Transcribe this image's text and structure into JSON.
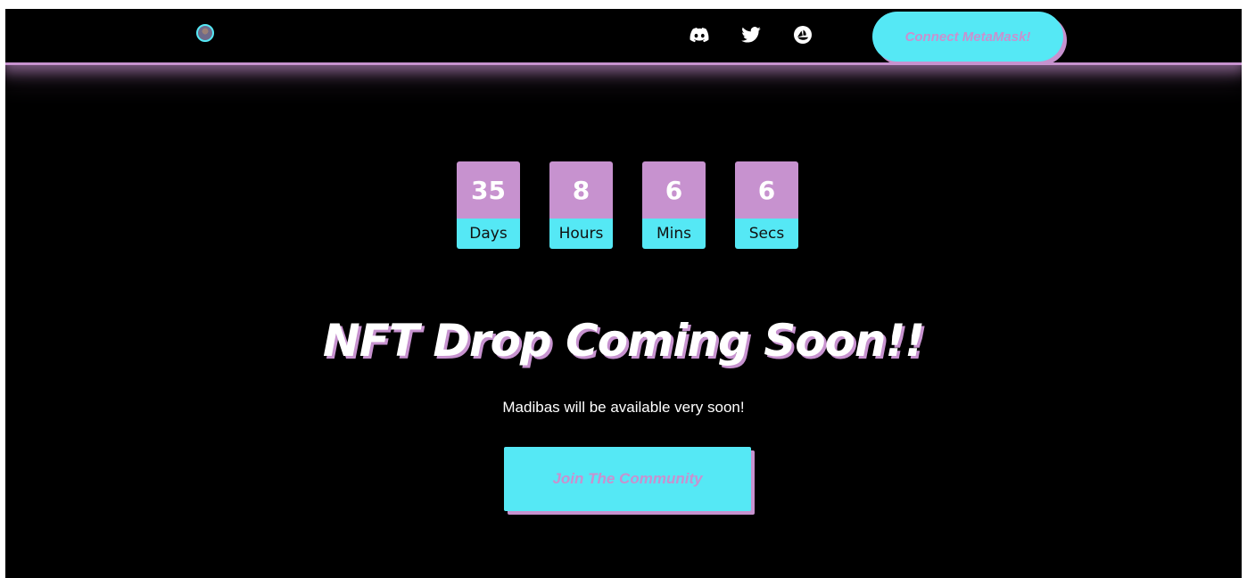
{
  "navbar": {
    "avatar_icon": "avatar-logo",
    "social_links": [
      {
        "icon": "discord-icon"
      },
      {
        "icon": "twitter-icon"
      },
      {
        "icon": "opensea-icon"
      }
    ],
    "connect_label": "Connect MetaMask!"
  },
  "countdown": {
    "units": [
      {
        "value": "35",
        "label": "Days"
      },
      {
        "value": "8",
        "label": "Hours"
      },
      {
        "value": "6",
        "label": "Mins"
      },
      {
        "value": "6",
        "label": "Secs"
      }
    ]
  },
  "hero": {
    "headline": "NFT Drop Coming Soon!!",
    "subtext": "Madibas will be available very soon!",
    "join_label": "Join The Community"
  },
  "colors": {
    "background": "#000000",
    "accent_cyan": "#55e8f5",
    "accent_pink": "#c792cf",
    "text": "#ffffff"
  }
}
